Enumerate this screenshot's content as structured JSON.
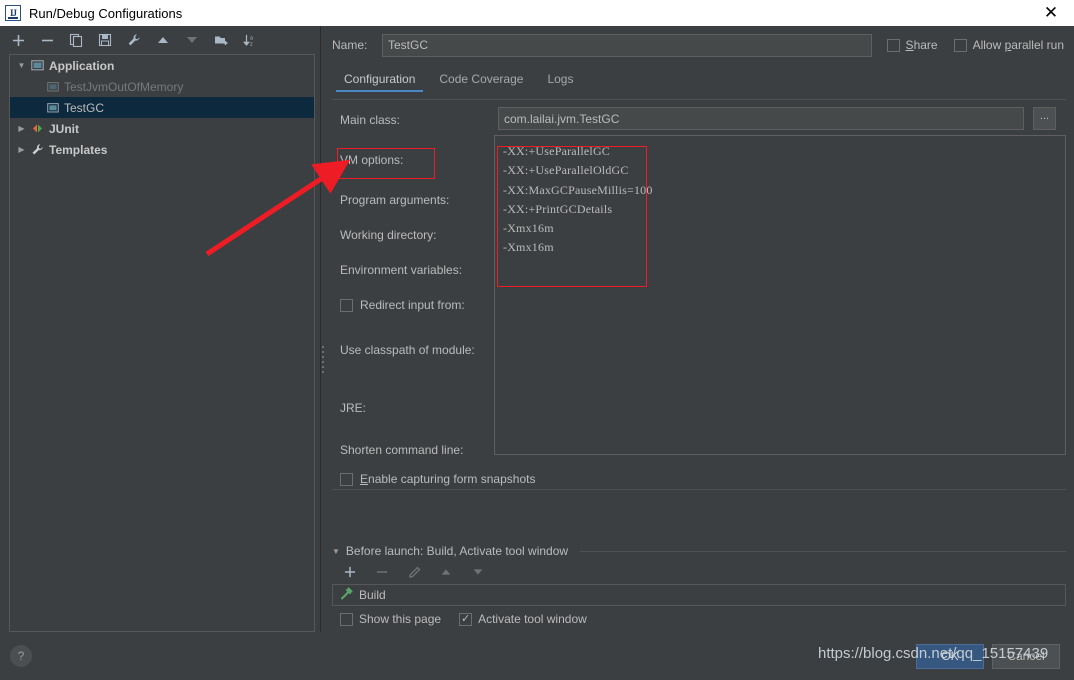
{
  "window": {
    "title": "Run/Debug Configurations",
    "app_icon": "intellij-idea-logo-icon",
    "close_label": "✕"
  },
  "sidebar": {
    "toolbar": [
      {
        "name": "add-configuration-button",
        "icon": "plus-icon",
        "label": "+"
      },
      {
        "name": "remove-configuration-button",
        "icon": "minus-icon",
        "label": "−"
      },
      {
        "name": "copy-configuration-button",
        "icon": "copy-icon",
        "label": ""
      },
      {
        "name": "save-configuration-button",
        "icon": "save-icon",
        "label": ""
      },
      {
        "name": "edit-templates-button",
        "icon": "wrench-icon",
        "label": ""
      },
      {
        "name": "move-up-button",
        "icon": "arrow-up-icon",
        "label": ""
      },
      {
        "name": "move-down-button",
        "icon": "arrow-down-icon",
        "label": ""
      },
      {
        "name": "new-folder-button",
        "icon": "folder-add-icon",
        "label": ""
      },
      {
        "name": "sort-configurations-button",
        "icon": "sort-az-icon",
        "label": ""
      }
    ],
    "tree": [
      {
        "label": "Application",
        "icon": "application-icon",
        "level": 0,
        "expanded": true,
        "selected": false,
        "bold": true,
        "muted": false
      },
      {
        "label": "TestJvmOutOfMemory",
        "icon": "run-config-icon",
        "level": 1,
        "expanded": null,
        "selected": false,
        "bold": false,
        "muted": true
      },
      {
        "label": "TestGC",
        "icon": "run-config-icon",
        "level": 1,
        "expanded": null,
        "selected": true,
        "bold": false,
        "muted": false
      },
      {
        "label": "JUnit",
        "icon": "junit-icon",
        "level": 0,
        "expanded": false,
        "selected": false,
        "bold": true,
        "muted": false
      },
      {
        "label": "Templates",
        "icon": "wrench-icon",
        "level": 0,
        "expanded": false,
        "selected": false,
        "bold": true,
        "muted": false
      }
    ]
  },
  "main": {
    "name_label": "Name:",
    "name_value": "TestGC",
    "share_label": "Share",
    "share_mnemonic": "S",
    "share_checked": false,
    "parallel_label": "Allow parallel run",
    "parallel_mnemonic": "p",
    "parallel_checked": false,
    "tabs": [
      {
        "label": "Configuration",
        "active": true
      },
      {
        "label": "Code Coverage",
        "active": false
      },
      {
        "label": "Logs",
        "active": false
      }
    ],
    "fields": {
      "main_class_label": "Main class:",
      "main_class_value": "com.lailai.jvm.TestGC",
      "browse_label": "...",
      "vm_options_label": "VM options:",
      "vm_options_value": "-XX:+UseParallelGC\n-XX:+UseParallelOldGC\n-XX:MaxGCPauseMillis=100\n-XX:+PrintGCDetails\n-Xmx16m\n-Xmx16m",
      "program_arguments_label": "Program arguments:",
      "program_arguments_value": "",
      "working_directory_label": "Working directory:",
      "working_directory_value": "",
      "environment_variables_label": "Environment variables:",
      "environment_variables_value": "",
      "redirect_input_label": "Redirect input from:",
      "redirect_input_checked": false,
      "use_classpath_label": "Use classpath of module:",
      "jre_label": "JRE:",
      "shorten_command_line_label": "Shorten command line:",
      "enable_capturing_label": "Enable capturing form snapshots",
      "enable_capturing_mnemonic": "E",
      "enable_capturing_checked": false
    },
    "before_launch": {
      "header": "Before launch: Build, Activate tool window",
      "toolbar": [
        {
          "name": "add-task-button",
          "icon": "plus-icon",
          "label": "+"
        },
        {
          "name": "remove-task-button",
          "icon": "minus-icon",
          "label": "−"
        },
        {
          "name": "edit-task-button",
          "icon": "pencil-icon",
          "label": ""
        },
        {
          "name": "move-task-up-button",
          "icon": "arrow-up-icon",
          "label": ""
        },
        {
          "name": "move-task-down-button",
          "icon": "arrow-down-icon",
          "label": ""
        }
      ],
      "items": [
        {
          "label": "Build",
          "icon": "build-hammer-icon"
        }
      ],
      "show_page_label": "Show this page",
      "show_page_checked": false,
      "activate_tool_window_label": "Activate tool window",
      "activate_tool_window_checked": true
    }
  },
  "footer": {
    "help_label": "?",
    "ok_label": "OK",
    "cancel_label": "Cancel",
    "watermark": "https://blog.csdn.net/qq_15157439"
  },
  "annotations": {
    "highlight_color": "#ee1c25",
    "arrow_name": "red-annotation-arrow",
    "boxes": [
      "vm-options-label-highlight",
      "vm-options-value-highlight"
    ]
  },
  "colors": {
    "background": "#3c3f41",
    "selection": "#0d293e",
    "accent": "#4a88c7",
    "primary_button": "#365880",
    "annotation": "#ee1c25"
  }
}
